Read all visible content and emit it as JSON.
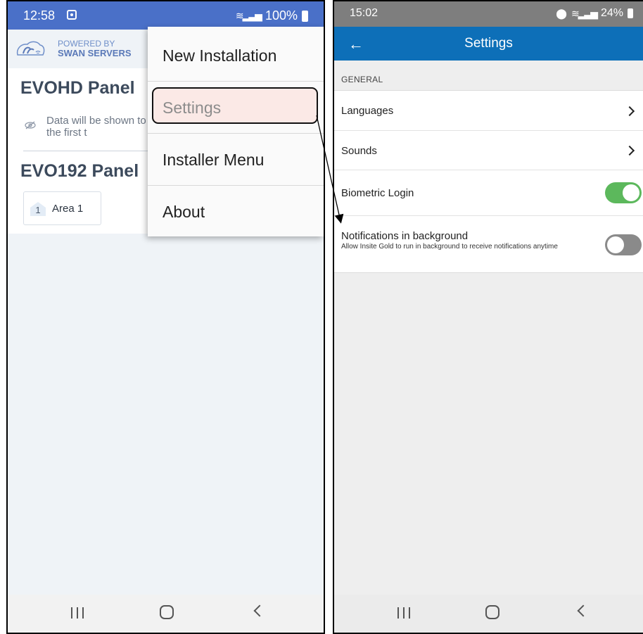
{
  "left_phone": {
    "status_bar": {
      "time": "12:58",
      "battery": "100%"
    },
    "header": {
      "powered_by": "POWERED BY",
      "brand": "SWAN SERVERS"
    },
    "panels": [
      {
        "title": "EVOHD Panel",
        "notice": "Data will be shown to site for the first t"
      },
      {
        "title": "EVO192 Panel",
        "area": {
          "number": "1",
          "label": "Area 1"
        }
      }
    ],
    "menu": {
      "items": [
        "New Installation",
        "Settings",
        "Installer Menu",
        "About"
      ],
      "highlighted": "Settings"
    }
  },
  "right_phone": {
    "status_bar": {
      "time": "15:02",
      "battery": "24%"
    },
    "appbar": {
      "title": "Settings"
    },
    "section_header": "GENERAL",
    "settings": [
      {
        "label": "Languages",
        "control": "chevron"
      },
      {
        "label": "Sounds",
        "control": "chevron"
      },
      {
        "label": "Biometric Login",
        "control": "toggle",
        "enabled": true
      },
      {
        "label": "Notifications in background",
        "sublabel": "Allow Insite Gold to run in background to receive notifications anytime",
        "control": "toggle",
        "enabled": false
      }
    ]
  },
  "colors": {
    "left_status_bar": "#4a70c8",
    "right_status_bar": "#7e7e7e",
    "appbar": "#0d6fb8",
    "toggle_on": "#5cb85c",
    "toggle_off": "#8a8a8a",
    "highlight_fill": "#fbe9e6"
  }
}
